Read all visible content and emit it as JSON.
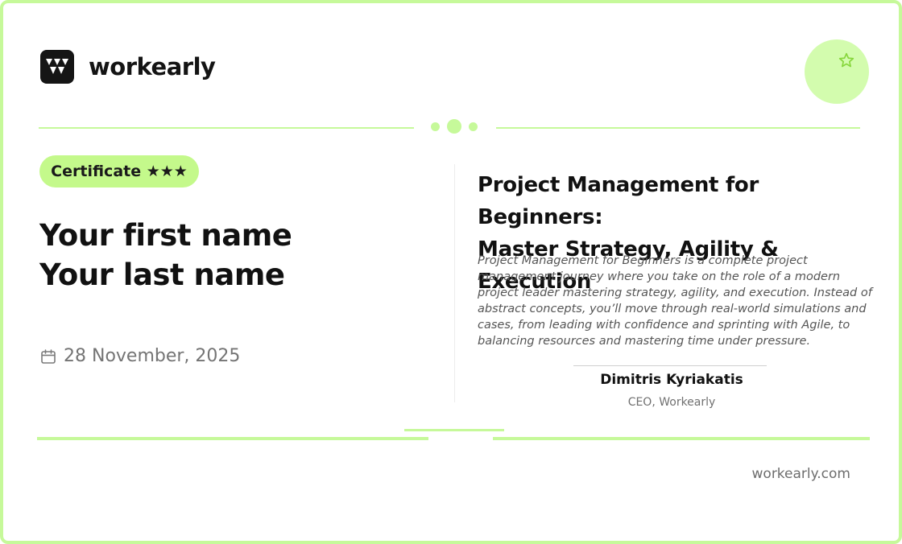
{
  "brand": {
    "name": "workearly",
    "website": "workearly.com"
  },
  "certificate": {
    "badge_label": "Certificate ★★★",
    "first_name": "Your first name",
    "last_name": "Your last name",
    "date": "28 November, 2025"
  },
  "course": {
    "title_line1": "Project Management for Beginners:",
    "title_line2": "Master Strategy, Agility & Execution",
    "description": "Project Management for Beginners is a complete project management journey where you take on the role of a modern project leader mastering strategy, agility, and execution. Instead of abstract concepts, you’ll move through real-world simulations and cases, from leading with confidence and sprinting with Agile, to balancing resources and mastering time under pressure."
  },
  "signature": {
    "name": "Dimitris Kyriakatis",
    "role": "CEO, Workearly"
  },
  "icons": {
    "logo": "workearly-logo-icon",
    "badge": "star-icon",
    "date": "calendar-icon"
  },
  "colors": {
    "accent": "#c6f99a",
    "pill": "#c4f98b",
    "badge_circle": "#d3fcae",
    "text": "#111111"
  }
}
